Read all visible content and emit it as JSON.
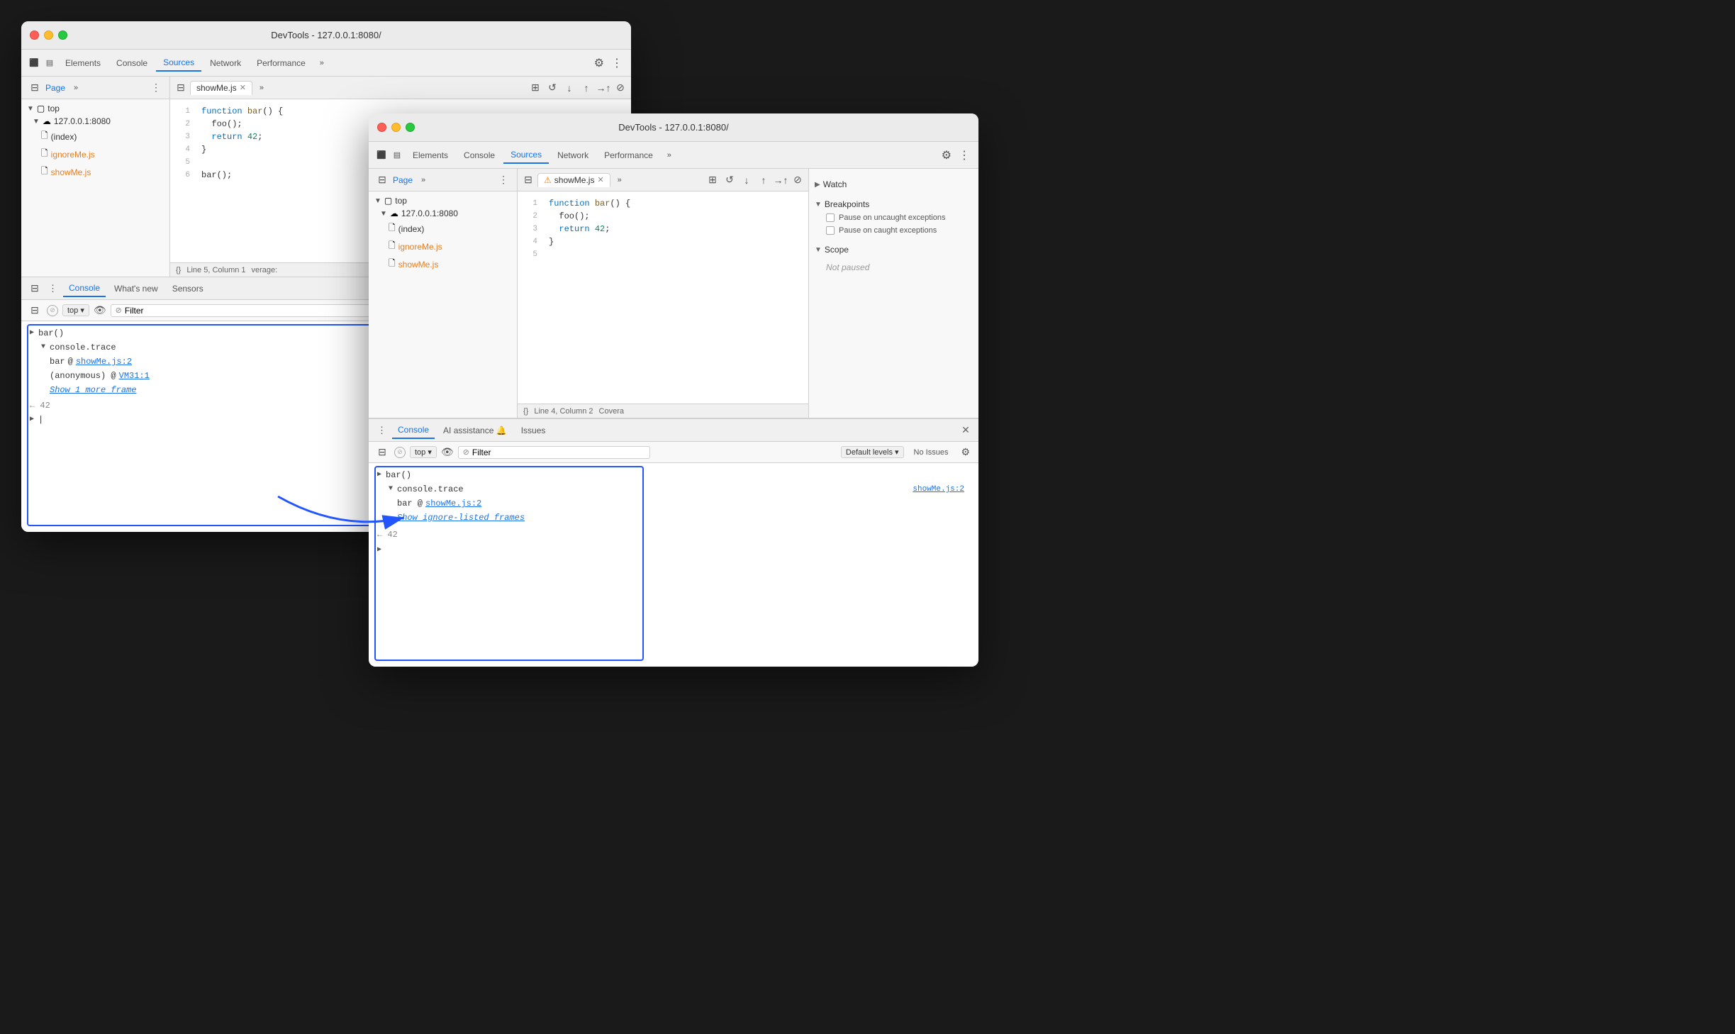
{
  "window1": {
    "title": "DevTools - 127.0.0.1:8080/",
    "tabs": [
      {
        "label": "Elements",
        "active": false
      },
      {
        "label": "Console",
        "active": false
      },
      {
        "label": "Sources",
        "active": true
      },
      {
        "label": "Network",
        "active": false
      },
      {
        "label": "Performance",
        "active": false
      }
    ],
    "sidebar": {
      "title": "Page",
      "tree": [
        {
          "label": "top",
          "level": 0,
          "type": "arrow",
          "arrow": "▼"
        },
        {
          "label": "127.0.0.1:8080",
          "level": 1,
          "type": "cloud",
          "arrow": "▼"
        },
        {
          "label": "(index)",
          "level": 2,
          "type": "file"
        },
        {
          "label": "ignoreMe.js",
          "level": 2,
          "type": "file-orange"
        },
        {
          "label": "showMe.js",
          "level": 2,
          "type": "file-orange"
        }
      ]
    },
    "editor": {
      "filename": "showMe.js",
      "code": [
        {
          "num": "1",
          "content": "function bar() {"
        },
        {
          "num": "2",
          "content": "  foo();"
        },
        {
          "num": "3",
          "content": "  return 42;"
        },
        {
          "num": "4",
          "content": "}"
        },
        {
          "num": "5",
          "content": ""
        },
        {
          "num": "6",
          "content": "bar();"
        }
      ],
      "statusbar": "Line 5, Column 1"
    },
    "console": {
      "tabs": [
        "Console",
        "What's new",
        "Sensors"
      ],
      "entries": [
        {
          "type": "group",
          "text": "bar()"
        },
        {
          "type": "trace",
          "text": "console.trace"
        },
        {
          "type": "frame",
          "label": "bar",
          "at": "@",
          "link": "showMe.js:2"
        },
        {
          "type": "frame",
          "label": "(anonymous)",
          "at": "@",
          "link": "VM31:1"
        },
        {
          "type": "more",
          "text": "Show 1 more frame"
        },
        {
          "type": "result",
          "text": "42"
        },
        {
          "type": "input",
          "text": "|"
        }
      ]
    }
  },
  "window2": {
    "title": "DevTools - 127.0.0.1:8080/",
    "tabs": [
      {
        "label": "Elements",
        "active": false
      },
      {
        "label": "Console",
        "active": false
      },
      {
        "label": "Sources",
        "active": true
      },
      {
        "label": "Network",
        "active": false
      },
      {
        "label": "Performance",
        "active": false
      }
    ],
    "sidebar": {
      "title": "Page",
      "tree": [
        {
          "label": "top",
          "level": 0,
          "type": "arrow",
          "arrow": "▼"
        },
        {
          "label": "127.0.0.1:8080",
          "level": 1,
          "type": "cloud",
          "arrow": "▼"
        },
        {
          "label": "(index)",
          "level": 2,
          "type": "file"
        },
        {
          "label": "ignoreMe.js",
          "level": 2,
          "type": "file-orange"
        },
        {
          "label": "showMe.js",
          "level": 2,
          "type": "file-orange"
        }
      ]
    },
    "editor": {
      "filename": "showMe.js",
      "warning": true,
      "code": [
        {
          "num": "1",
          "content": "function bar() {"
        },
        {
          "num": "2",
          "content": "  foo();"
        },
        {
          "num": "3",
          "content": "  return 42;"
        },
        {
          "num": "4",
          "content": "}"
        },
        {
          "num": "5",
          "content": ""
        }
      ],
      "statusbar": "Line 4, Column 2"
    },
    "debugger": {
      "watch": "Watch",
      "breakpoints": "Breakpoints",
      "pause_uncaught": "Pause on uncaught exceptions",
      "pause_caught": "Pause on caught exceptions",
      "scope": "Scope",
      "not_paused": "Not paused"
    },
    "console": {
      "tabs": [
        "Console",
        "AI assistance",
        "Issues"
      ],
      "filter_placeholder": "Filter",
      "top_label": "top",
      "default_levels": "Default levels",
      "no_issues": "No Issues",
      "entries": [
        {
          "type": "group",
          "text": "bar()"
        },
        {
          "type": "trace",
          "text": "console.trace"
        },
        {
          "type": "frame",
          "label": "bar @",
          "link": "showMe.js:2"
        },
        {
          "type": "more",
          "text": "Show ignore-listed frames"
        },
        {
          "type": "result",
          "text": "42"
        },
        {
          "type": "input"
        }
      ],
      "source_link": "showMe.js:2"
    }
  },
  "icons": {
    "elements": "⬜",
    "console_panel": "☰",
    "more": "»",
    "three_dots": "⋮",
    "gear": "⚙",
    "filter": "⊘",
    "eye": "👁",
    "close": "✕",
    "warning": "⚠"
  }
}
